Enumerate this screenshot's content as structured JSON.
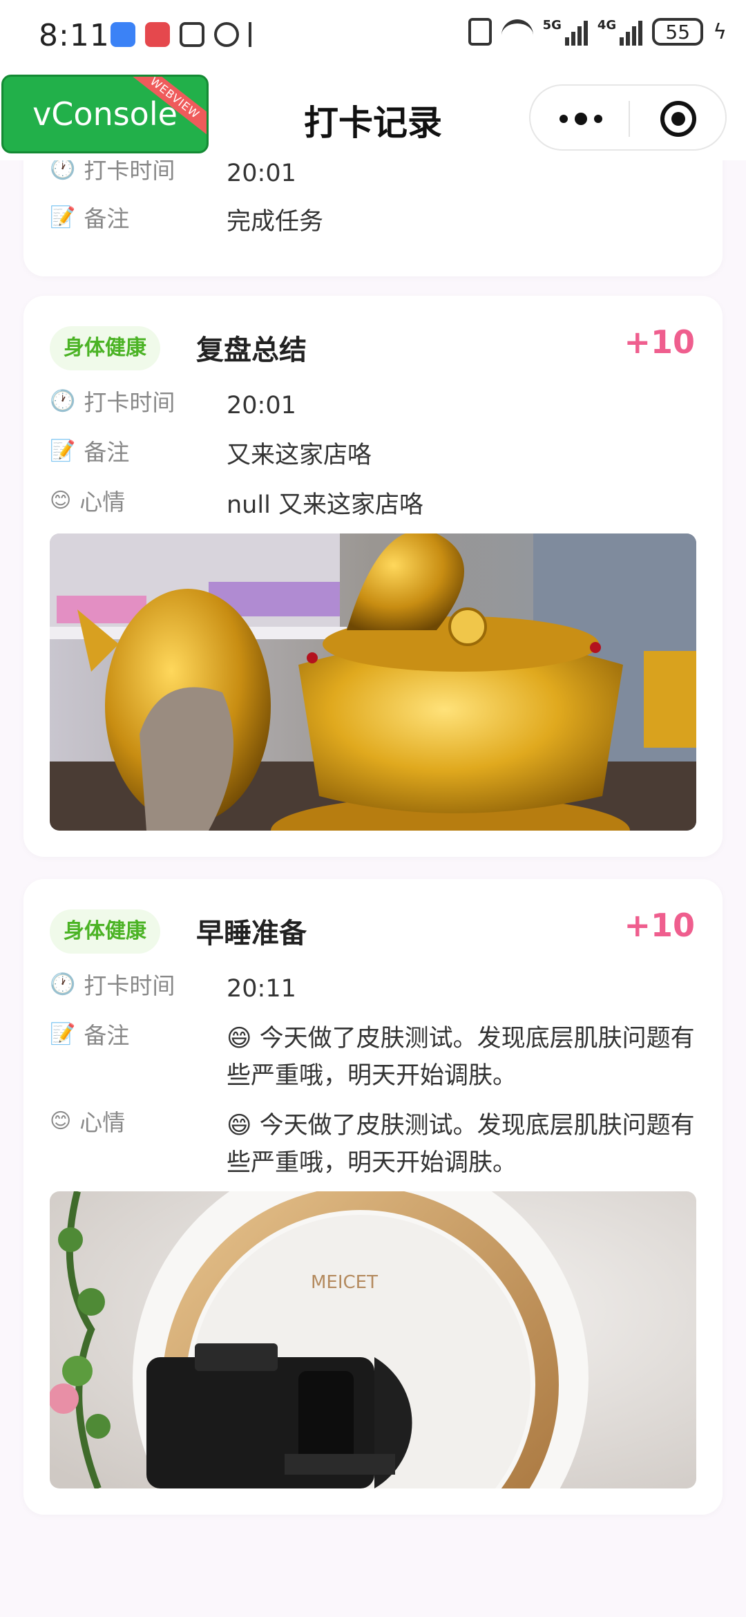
{
  "status": {
    "time": "8:11",
    "sig5g": "5G",
    "sig4g": "4G",
    "battery": "55"
  },
  "nav": {
    "title": "打卡记录",
    "vconsole_label": "vConsole",
    "vconsole_badge": "WEBVIEW"
  },
  "labels": {
    "time": "打卡时间",
    "note": "备注",
    "mood": "心情"
  },
  "cards": [
    {
      "time": "20:01",
      "note": "完成任务"
    },
    {
      "tag": "身体健康",
      "title": "复盘总结",
      "points": "+10",
      "time": "20:01",
      "note": "又来这家店咯",
      "mood": "null 又来这家店咯",
      "photo_alt": "gold-figurines-photo"
    },
    {
      "tag": "身体健康",
      "title": "早睡准备",
      "points": "+10",
      "time": "20:11",
      "note": "😄 今天做了皮肤测试。发现底层肌肤问题有些严重哦，明天开始调肤。",
      "mood": "😄 今天做了皮肤测试。发现底层肌肤问题有些严重哦，明天开始调肤。",
      "photo_alt": "skin-test-device-photo",
      "photo_brand": "MEICET"
    }
  ],
  "colors": {
    "tag_bg": "#f0faea",
    "tag_text": "#4bb325",
    "points": "#ef5e8e",
    "vconsole": "#22b04a",
    "page_bg": "#fbf7fc"
  }
}
